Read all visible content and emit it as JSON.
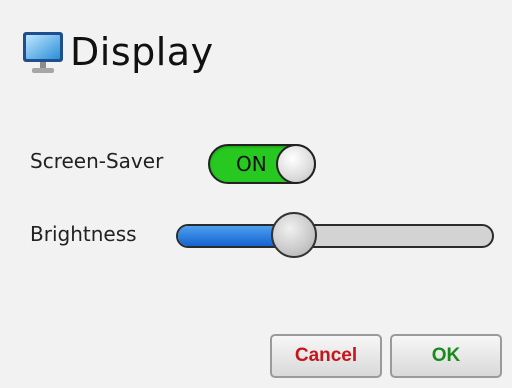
{
  "header": {
    "title": "Display",
    "icon": "monitor-icon"
  },
  "screen_saver": {
    "label": "Screen-Saver",
    "state_text": "ON",
    "on": true,
    "accent": "#27c81f"
  },
  "brightness": {
    "label": "Brightness",
    "level": 0.37,
    "accent": "#1e6fd6"
  },
  "buttons": {
    "cancel_label": "Cancel",
    "ok_label": "OK",
    "cancel_color": "#c4161c",
    "ok_color": "#1a8a1a"
  }
}
